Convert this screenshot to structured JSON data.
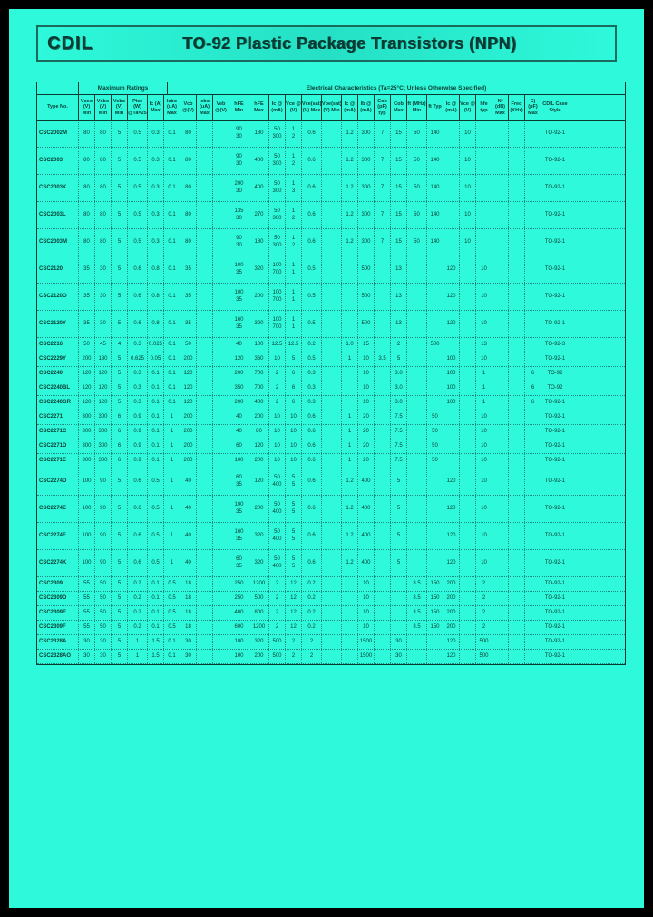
{
  "logo": "CDIL",
  "title": "TO-92 Plastic Package Transistors (NPN)",
  "header_groups": {
    "max_ratings": "Maximum Ratings",
    "elec_char": "Electrical Characteristics (Ta=25°C; Unless Otherwise Specified)"
  },
  "col_headers": [
    "Type\nNo.",
    "Vceo\n(V)\nMin",
    "Vcbo\n(V)\nMin",
    "Vebo\n(V)\nMin",
    "Ptot\n(W)\n@Ta=25°C",
    "Ic\n(A)\nMax",
    "Icbo\n(uA)\nMax",
    "Vcb\n@(V)",
    "Iebo\n(uA)\nMax",
    "Veb\n@(V)",
    "hFE\nMin",
    "hFE\nMax",
    "Ic\n@\n(mA)",
    "Vce\n@\n(V)",
    "Vce(sat)\n(V)\nMax",
    "Vbe(sat)\n(V)\nMin",
    "Ic\n@\n(mA)",
    "Ib\n@\n(mA)",
    "Cob\n(pF)\ntyp",
    "Cob\nMax",
    "ft\n(MHz)\nMin",
    "ft\nTyp",
    "Ic\n@\n(mA)",
    "Vce\n@\n(V)",
    "hfe\ntyp",
    "Nf\n(dB)\nMax",
    "Freq\n(KHz)",
    "Cj\n(pF)\nMax",
    "CDIL\nCase\nStyle"
  ],
  "rows": [
    {
      "tall": true,
      "c": [
        "CSC2002M",
        "80",
        "80",
        "5",
        "0.5",
        "0.3",
        "0.1",
        "80",
        "",
        "",
        "90\n30",
        "180\n",
        "50\n300",
        "1\n2",
        "0.6",
        "",
        "1.2",
        "300",
        "7",
        "15",
        "50",
        "140",
        "",
        "10",
        "",
        "",
        "",
        "",
        "TO-92-1"
      ]
    },
    {
      "tall": true,
      "c": [
        "CSC2003",
        "80",
        "80",
        "5",
        "0.5",
        "0.3",
        "0.1",
        "80",
        "",
        "",
        "90\n30",
        "400\n",
        "50\n300",
        "1\n2",
        "0.6",
        "",
        "1.2",
        "300",
        "7",
        "15",
        "50",
        "140",
        "",
        "10",
        "",
        "",
        "",
        "",
        "TO-92-1"
      ]
    },
    {
      "tall": true,
      "c": [
        "CSC2003K",
        "80",
        "80",
        "5",
        "0.5",
        "0.3",
        "0.1",
        "80",
        "",
        "",
        "200\n30",
        "400\n",
        "50\n300",
        "1\n3",
        "0.6",
        "",
        "1.2",
        "300",
        "7",
        "15",
        "50",
        "140",
        "",
        "10",
        "",
        "",
        "",
        "",
        "TO-92-1"
      ]
    },
    {
      "tall": true,
      "c": [
        "CSC2003L",
        "80",
        "80",
        "5",
        "0.5",
        "0.3",
        "0.1",
        "80",
        "",
        "",
        "135\n30",
        "270\n",
        "50\n300",
        "1\n2",
        "0.6",
        "",
        "1.2",
        "300",
        "7",
        "15",
        "50",
        "140",
        "",
        "10",
        "",
        "",
        "",
        "",
        "TO-92-1"
      ]
    },
    {
      "tall": true,
      "c": [
        "CSC2003M",
        "80",
        "80",
        "5",
        "0.5",
        "0.3",
        "0.1",
        "80",
        "",
        "",
        "90\n30",
        "180\n",
        "50\n300",
        "1\n2",
        "0.6",
        "",
        "1.2",
        "300",
        "7",
        "15",
        "50",
        "140",
        "",
        "10",
        "",
        "",
        "",
        "",
        "TO-92-1"
      ]
    },
    {
      "tall": true,
      "c": [
        "CSC2120",
        "35",
        "30",
        "5",
        "0.6",
        "0.8",
        "0.1",
        "35",
        "",
        "",
        "100\n35",
        "320\n",
        "100\n700",
        "1\n1",
        "0.5",
        "",
        "",
        "500",
        "",
        "13",
        "",
        "",
        "120",
        "",
        "10",
        "",
        "",
        "",
        "TO-92-1"
      ]
    },
    {
      "tall": true,
      "c": [
        "CSC2120O",
        "35",
        "30",
        "5",
        "0.6",
        "0.8",
        "0.1",
        "35",
        "",
        "",
        "100\n35",
        "200\n",
        "100\n700",
        "1\n1",
        "0.5",
        "",
        "",
        "500",
        "",
        "13",
        "",
        "",
        "120",
        "",
        "10",
        "",
        "",
        "",
        "TO-92-1"
      ]
    },
    {
      "tall": true,
      "c": [
        "CSC2120Y",
        "35",
        "30",
        "5",
        "0.6",
        "0.8",
        "0.1",
        "35",
        "",
        "",
        "160\n35",
        "320\n",
        "100\n700",
        "1\n1",
        "0.5",
        "",
        "",
        "500",
        "",
        "13",
        "",
        "",
        "120",
        "",
        "10",
        "",
        "",
        "",
        "TO-92-1"
      ]
    },
    {
      "c": [
        "CSC2216",
        "50",
        "45",
        "4",
        "0.3",
        "0.025",
        "0.1",
        "50",
        "",
        "",
        "40",
        "100",
        "12.5",
        "12.5",
        "0.2",
        "",
        "1.0",
        "15",
        "",
        "2",
        "",
        "500",
        "",
        "",
        "13",
        "",
        "",
        "",
        "TO-92-3"
      ]
    },
    {
      "c": [
        "CSC2229Y",
        "200",
        "180",
        "5",
        "0.625",
        "0.05",
        "0.1",
        "200",
        "",
        "",
        "120",
        "360",
        "10",
        "5",
        "0.5",
        "",
        "1",
        "10",
        "3.5",
        "5",
        "",
        "",
        "100",
        "",
        "10",
        "",
        "",
        "",
        "TO-92-1"
      ]
    },
    {
      "c": [
        "CSC2240",
        "120",
        "120",
        "5",
        "0.3",
        "0.1",
        "0.1",
        "120",
        "",
        "",
        "200",
        "700",
        "2",
        "6",
        "0.3",
        "",
        "",
        "10",
        "",
        "3.0",
        "",
        "",
        "100",
        "",
        "1",
        "",
        "",
        "6",
        "TO-92"
      ]
    },
    {
      "c": [
        "CSC2240BL",
        "120",
        "120",
        "5",
        "0.3",
        "0.1",
        "0.1",
        "120",
        "",
        "",
        "350",
        "700",
        "2",
        "6",
        "0.3",
        "",
        "",
        "10",
        "",
        "3.0",
        "",
        "",
        "100",
        "",
        "1",
        "",
        "",
        "6",
        "TO-92"
      ]
    },
    {
      "c": [
        "CSC2240GR",
        "120",
        "120",
        "5",
        "0.3",
        "0.1",
        "0.1",
        "120",
        "",
        "",
        "200",
        "400",
        "2",
        "6",
        "0.3",
        "",
        "",
        "10",
        "",
        "3.0",
        "",
        "",
        "100",
        "",
        "1",
        "",
        "",
        "6",
        "TO-92-1"
      ]
    },
    {
      "c": [
        "CSC2271",
        "300",
        "300",
        "6",
        "0.9",
        "0.1",
        "1",
        "200",
        "",
        "",
        "40",
        "200",
        "10",
        "10",
        "0.6",
        "",
        "1",
        "20",
        "",
        "7.5",
        "",
        "50",
        "",
        "",
        "10",
        "",
        "",
        "",
        "TO-92-1"
      ]
    },
    {
      "c": [
        "CSC2271C",
        "300",
        "300",
        "6",
        "0.9",
        "0.1",
        "1",
        "200",
        "",
        "",
        "40",
        "80",
        "10",
        "10",
        "0.6",
        "",
        "1",
        "20",
        "",
        "7.5",
        "",
        "50",
        "",
        "",
        "10",
        "",
        "",
        "",
        "TO-92-1"
      ]
    },
    {
      "c": [
        "CSC2271D",
        "300",
        "300",
        "6",
        "0.9",
        "0.1",
        "1",
        "200",
        "",
        "",
        "60",
        "120",
        "10",
        "10",
        "0.6",
        "",
        "1",
        "20",
        "",
        "7.5",
        "",
        "50",
        "",
        "",
        "10",
        "",
        "",
        "",
        "TO-92-1"
      ]
    },
    {
      "c": [
        "CSC2271E",
        "300",
        "300",
        "6",
        "0.9",
        "0.1",
        "1",
        "200",
        "",
        "",
        "100",
        "200",
        "10",
        "10",
        "0.6",
        "",
        "1",
        "20",
        "",
        "7.5",
        "",
        "50",
        "",
        "",
        "10",
        "",
        "",
        "",
        "TO-92-1"
      ]
    },
    {
      "tall": true,
      "c": [
        "CSC2274D",
        "100",
        "90",
        "5",
        "0.6",
        "0.5",
        "1",
        "40",
        "",
        "",
        "60\n35",
        "120\n",
        "50\n400",
        "5\n5",
        "0.6",
        "",
        "1.2",
        "400",
        "",
        "5",
        "",
        "",
        "120",
        "",
        "10",
        "",
        "",
        "",
        "TO-92-1"
      ]
    },
    {
      "tall": true,
      "c": [
        "CSC2274E",
        "100",
        "90",
        "5",
        "0.6",
        "0.5",
        "1",
        "40",
        "",
        "",
        "100\n35",
        "200\n",
        "50\n400",
        "5\n5",
        "0.6",
        "",
        "1.2",
        "400",
        "",
        "5",
        "",
        "",
        "120",
        "",
        "10",
        "",
        "",
        "",
        "TO-92-1"
      ]
    },
    {
      "tall": true,
      "c": [
        "CSC2274F",
        "100",
        "90",
        "5",
        "0.6",
        "0.5",
        "1",
        "40",
        "",
        "",
        "160\n35",
        "320\n",
        "50\n400",
        "5\n5",
        "0.6",
        "",
        "1.2",
        "400",
        "",
        "5",
        "",
        "",
        "120",
        "",
        "10",
        "",
        "",
        "",
        "TO-92-1"
      ]
    },
    {
      "tall": true,
      "c": [
        "CSC2274K",
        "100",
        "90",
        "5",
        "0.6",
        "0.5",
        "1",
        "40",
        "",
        "",
        "60\n35",
        "320\n",
        "50\n400",
        "5\n5",
        "0.6",
        "",
        "1.2",
        "400",
        "",
        "5",
        "",
        "",
        "120",
        "",
        "10",
        "",
        "",
        "",
        "TO-92-1"
      ]
    },
    {
      "c": [
        "CSC2309",
        "55",
        "50",
        "5",
        "0.2",
        "0.1",
        "0.5",
        "18",
        "",
        "",
        "250",
        "1200",
        "2",
        "12",
        "0.2",
        "",
        "",
        "10",
        "",
        "",
        "3.5",
        "150",
        "200",
        "",
        "2",
        "",
        "",
        "",
        "TO-92-1"
      ]
    },
    {
      "c": [
        "CSC2309D",
        "55",
        "50",
        "5",
        "0.2",
        "0.1",
        "0.5",
        "18",
        "",
        "",
        "250",
        "500",
        "2",
        "12",
        "0.2",
        "",
        "",
        "10",
        "",
        "",
        "3.5",
        "150",
        "200",
        "",
        "2",
        "",
        "",
        "",
        "TO-92-1"
      ]
    },
    {
      "c": [
        "CSC2309E",
        "55",
        "50",
        "5",
        "0.2",
        "0.1",
        "0.5",
        "18",
        "",
        "",
        "400",
        "800",
        "2",
        "12",
        "0.2",
        "",
        "",
        "10",
        "",
        "",
        "3.5",
        "150",
        "200",
        "",
        "2",
        "",
        "",
        "",
        "TO-92-1"
      ]
    },
    {
      "c": [
        "CSC2309F",
        "55",
        "50",
        "5",
        "0.2",
        "0.1",
        "0.5",
        "18",
        "",
        "",
        "600",
        "1200",
        "2",
        "12",
        "0.2",
        "",
        "",
        "10",
        "",
        "",
        "3.5",
        "150",
        "200",
        "",
        "2",
        "",
        "",
        "",
        "TO-92-1"
      ]
    },
    {
      "c": [
        "CSC2328A",
        "30",
        "30",
        "5",
        "1",
        "1.5",
        "0.1",
        "30",
        "",
        "",
        "100",
        "320",
        "500",
        "2",
        "2",
        "",
        "",
        "1500",
        "",
        "30",
        "",
        "",
        "120",
        "",
        "500",
        "",
        "",
        "",
        "TO-92-1"
      ]
    },
    {
      "c": [
        "CSC2328AO",
        "30",
        "30",
        "5",
        "1",
        "1.5",
        "0.1",
        "30",
        "",
        "",
        "100",
        "200",
        "500",
        "2",
        "2",
        "",
        "",
        "1500",
        "",
        "30",
        "",
        "",
        "120",
        "",
        "500",
        "",
        "",
        "",
        "TO-92-1"
      ]
    }
  ]
}
